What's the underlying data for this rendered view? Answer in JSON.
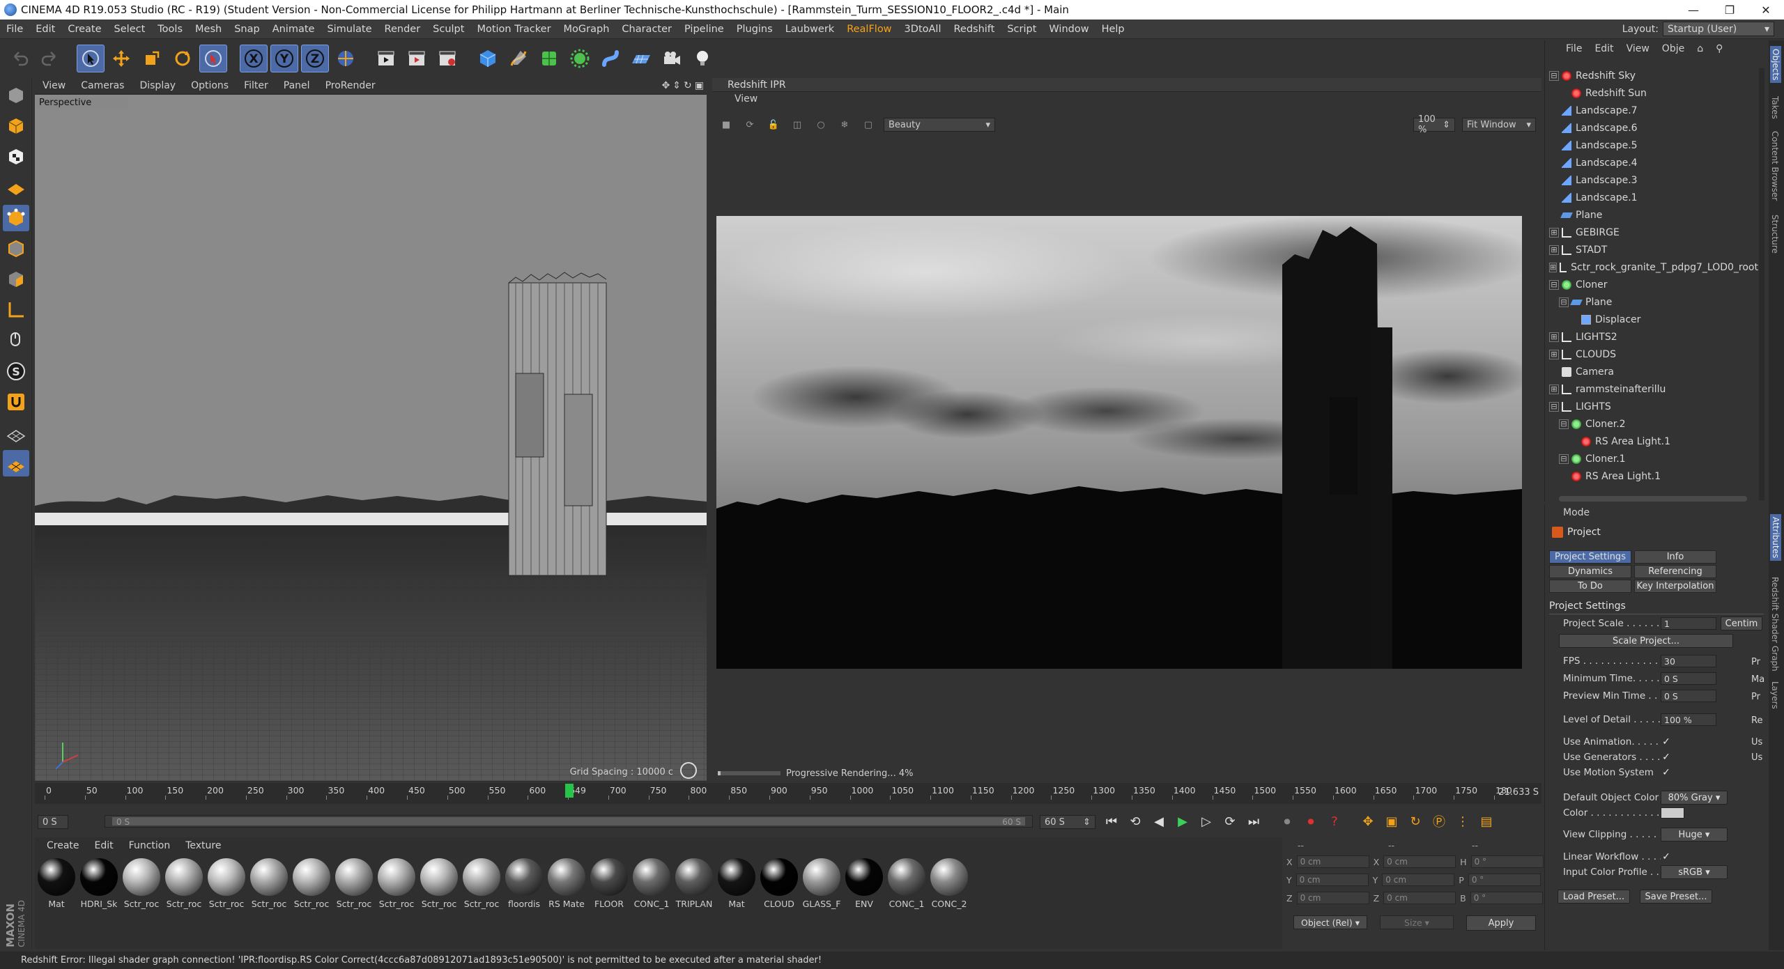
{
  "window": {
    "title": "CINEMA 4D R19.053 Studio (RC - R19) (Student Version - Non-Commercial License for Philipp Hartmann at Berliner Technische-Kunsthochschule) - [Rammstein_Turm_SESSION10_FLOOR2_.c4d *] - Main",
    "controls": [
      "—",
      "❐",
      "✕"
    ]
  },
  "menubar": {
    "items": [
      "File",
      "Edit",
      "Create",
      "Select",
      "Tools",
      "Mesh",
      "Snap",
      "Animate",
      "Simulate",
      "Render",
      "Sculpt",
      "Motion Tracker",
      "MoGraph",
      "Character",
      "Pipeline",
      "Plugins",
      "Laubwerk",
      "RealFlow",
      "3DtoAll",
      "Redshift",
      "Script",
      "Window",
      "Help"
    ],
    "highlighted_item": "RealFlow",
    "layout_label": "Layout:",
    "layout_value": "Startup (User)"
  },
  "toolbar": {
    "icons": [
      "undo-icon",
      "redo-icon",
      "live-selection-icon",
      "move-icon",
      "scale-icon",
      "rotate-icon",
      "select-tool-icon",
      "x-axis-icon",
      "y-axis-icon",
      "z-axis-icon",
      "world-coord-icon",
      "render-view-icon",
      "render-picture-viewer-icon",
      "render-settings-icon",
      "cube-icon",
      "pen-icon",
      "subdivision-icon",
      "cloner-icon",
      "deformer-icon",
      "floor-icon",
      "camera-icon",
      "light-icon"
    ]
  },
  "viewport": {
    "menu": [
      "View",
      "Cameras",
      "Display",
      "Options",
      "Filter",
      "Panel",
      "ProRender"
    ],
    "label": "Perspective",
    "grid_spacing": "Grid Spacing : 10000 c"
  },
  "ipr": {
    "title": "Redshift IPR",
    "view_menu": "View",
    "aov": "Beauty",
    "zoom": "100 %",
    "fit": "Fit Window",
    "status": "Progressive Rendering... 4%",
    "progress": 0.04
  },
  "timeline": {
    "ticks": [
      "0",
      "50",
      "100",
      "150",
      "200",
      "250",
      "300",
      "350",
      "400",
      "450",
      "500",
      "550",
      "600",
      "649",
      "700",
      "750",
      "800",
      "850",
      "900",
      "950",
      "1000",
      "1050",
      "1100",
      "1150",
      "1200",
      "1250",
      "1300",
      "1350",
      "1400",
      "1450",
      "1500",
      "1550",
      "1600",
      "1650",
      "1700",
      "1750",
      "180"
    ],
    "current_frame": "649",
    "time_readout": "21.633 S",
    "start": "0 S",
    "range_start": "0 S",
    "range_end": "60 S",
    "end": "60 S"
  },
  "materials": {
    "menu": [
      "Create",
      "Edit",
      "Function",
      "Texture"
    ],
    "items": [
      {
        "name": "Mat",
        "color": "#111111"
      },
      {
        "name": "HDRI_Sk",
        "color": "#050505"
      },
      {
        "name": "Sctr_roc",
        "color": "#b8b8b8"
      },
      {
        "name": "Sctr_roc",
        "color": "#b0b0b0"
      },
      {
        "name": "Sctr_roc",
        "color": "#bdbdbd"
      },
      {
        "name": "Sctr_roc",
        "color": "#a8a8a8"
      },
      {
        "name": "Sctr_roc",
        "color": "#b5b5b5"
      },
      {
        "name": "Sctr_roc",
        "color": "#aaaaaa"
      },
      {
        "name": "Sctr_roc",
        "color": "#b2b2b2"
      },
      {
        "name": "Sctr_roc",
        "color": "#b9b9b9"
      },
      {
        "name": "Sctr_roc",
        "color": "#adadad"
      },
      {
        "name": "floordis",
        "color": "#5a5a5a"
      },
      {
        "name": "RS Mate",
        "color": "#777777"
      },
      {
        "name": "FLOOR",
        "color": "#4a4a4a"
      },
      {
        "name": "CONC_1",
        "color": "#6d6d6d"
      },
      {
        "name": "TRIPLAN",
        "color": "#5f5f5f"
      },
      {
        "name": "Mat",
        "color": "#151515"
      },
      {
        "name": "CLOUD",
        "color": "#020202"
      },
      {
        "name": "GLASS_F",
        "color": "#9a9a9a"
      },
      {
        "name": "ENV",
        "color": "#050505"
      },
      {
        "name": "CONC_1",
        "color": "#6a6a6a"
      },
      {
        "name": "CONC_2",
        "color": "#8a8a8a"
      }
    ]
  },
  "coords": {
    "header1": "--",
    "header2": "--",
    "header3": "--",
    "rows": [
      {
        "a": "X",
        "av": "0 cm",
        "b": "X",
        "bv": "0 cm",
        "c": "H",
        "cv": "0 °"
      },
      {
        "a": "Y",
        "av": "0 cm",
        "b": "Y",
        "bv": "0 cm",
        "c": "P",
        "cv": "0 °"
      },
      {
        "a": "Z",
        "av": "0 cm",
        "b": "Z",
        "bv": "0 cm",
        "c": "B",
        "cv": "0 °"
      }
    ],
    "mode": "Object (Rel)",
    "size": "Size",
    "apply": "Apply"
  },
  "statusbar": {
    "text": "Redshift Error: Illegal shader graph connection! 'IPR:floordisp.RS Color Correct(4ccc6a87d08912071ad1893c51e90500)' is not permitted to be executed after a material shader!"
  },
  "objects": {
    "menu": [
      "File",
      "Edit",
      "View",
      "Obje"
    ],
    "items": [
      {
        "name": "Redshift Sky",
        "icon": "sky",
        "indent": 0,
        "expand": "⊟"
      },
      {
        "name": "Redshift Sun",
        "icon": "sky",
        "indent": 1,
        "expand": ""
      },
      {
        "name": "Landscape.7",
        "icon": "land",
        "indent": 0,
        "expand": ""
      },
      {
        "name": "Landscape.6",
        "icon": "land",
        "indent": 0,
        "expand": ""
      },
      {
        "name": "Landscape.5",
        "icon": "land",
        "indent": 0,
        "expand": ""
      },
      {
        "name": "Landscape.4",
        "icon": "land",
        "indent": 0,
        "expand": ""
      },
      {
        "name": "Landscape.3",
        "icon": "land",
        "indent": 0,
        "expand": ""
      },
      {
        "name": "Landscape.1",
        "icon": "land",
        "indent": 0,
        "expand": ""
      },
      {
        "name": "Plane",
        "icon": "plane",
        "indent": 0,
        "expand": ""
      },
      {
        "name": "GEBIRGE",
        "icon": "null",
        "indent": 0,
        "expand": "⊞"
      },
      {
        "name": "STADT",
        "icon": "null",
        "indent": 0,
        "expand": "⊞"
      },
      {
        "name": "Sctr_rock_granite_T_pdpg7_LOD0_root",
        "icon": "null",
        "indent": 0,
        "expand": "⊞"
      },
      {
        "name": "Cloner",
        "icon": "clone",
        "indent": 0,
        "expand": "⊟"
      },
      {
        "name": "Plane",
        "icon": "plane",
        "indent": 1,
        "expand": "⊟"
      },
      {
        "name": "Displacer",
        "icon": "disp",
        "indent": 2,
        "expand": ""
      },
      {
        "name": "LIGHTS2",
        "icon": "null",
        "indent": 0,
        "expand": "⊞"
      },
      {
        "name": "CLOUDS",
        "icon": "null",
        "indent": 0,
        "expand": "⊞"
      },
      {
        "name": "Camera",
        "icon": "cam",
        "indent": 0,
        "expand": ""
      },
      {
        "name": "rammsteinafterillu",
        "icon": "null",
        "indent": 0,
        "expand": "⊞"
      },
      {
        "name": "LIGHTS",
        "icon": "null",
        "indent": 0,
        "expand": "⊟"
      },
      {
        "name": "Cloner.2",
        "icon": "clone",
        "indent": 1,
        "expand": "⊟"
      },
      {
        "name": "RS Area Light.1",
        "icon": "sky",
        "indent": 2,
        "expand": ""
      },
      {
        "name": "Cloner.1",
        "icon": "clone",
        "indent": 1,
        "expand": "⊟"
      },
      {
        "name": "RS Area Light.1",
        "icon": "sky",
        "indent": 1,
        "expand": ""
      }
    ]
  },
  "attributes": {
    "mode": "Mode",
    "object": "Project",
    "tabs": [
      {
        "label": "Project Settings",
        "active": true
      },
      {
        "label": "Info",
        "active": false
      },
      {
        "label": "Dynamics",
        "active": false
      },
      {
        "label": "Referencing",
        "active": false
      },
      {
        "label": "To Do",
        "active": false
      },
      {
        "label": "Key Interpolation",
        "active": false
      }
    ],
    "section": "Project Settings",
    "project_scale_label": "Project Scale . . . . . .",
    "project_scale_value": "1",
    "project_scale_unit": "Centim",
    "scale_project_btn": "Scale Project...",
    "fps_label": "FPS . . . . . . . . . . . . . . .",
    "fps_value": "30",
    "min_time_label": "Minimum Time. . . . .",
    "min_time_value": "0 S",
    "preview_min_label": "Preview Min Time . .",
    "preview_min_value": "0 S",
    "lod_label": "Level of Detail . . . . .",
    "lod_value": "100 %",
    "use_animation": "Use Animation. . . . .",
    "use_generators": "Use Generators . . . .",
    "use_motion": "Use Motion System",
    "default_color_label": "Default Object Color",
    "default_color_value": "80% Gray",
    "color_label": "Color . . . . . . . . . . . . .",
    "view_clipping_label": "View Clipping . . . . . .",
    "view_clipping_value": "Huge",
    "linear_workflow": "Linear Workflow . . . .",
    "input_profile_label": "Input Color Profile . .",
    "input_profile_value": "sRGB",
    "load_preset": "Load Preset...",
    "save_preset": "Save Preset...",
    "cut_right": [
      "Pr",
      "Ma",
      "Pr",
      "Re",
      "Us",
      "Us"
    ],
    "check": "✓"
  },
  "right_tabs": [
    "Objects",
    "Takes",
    "Content Browser",
    "Structure",
    "Attributes",
    "Redshift Shader Graph",
    "Layers"
  ]
}
